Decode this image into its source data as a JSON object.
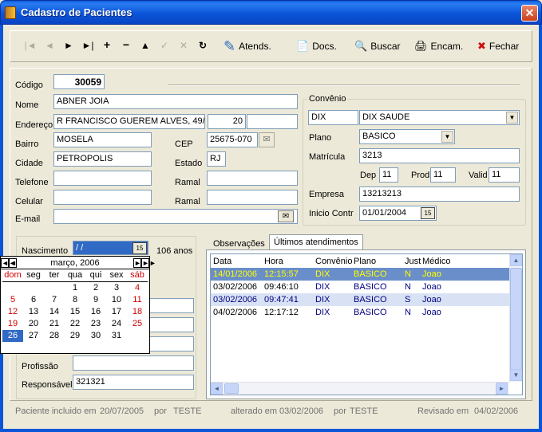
{
  "window": {
    "title": "Cadastro de Pacientes",
    "close": "✕"
  },
  "toolbar": {
    "nav": [
      "|◄",
      "◄",
      "►",
      "►|",
      "+",
      "−",
      "▲",
      "✓",
      "✕",
      "↻"
    ],
    "buttons": [
      {
        "icon": "✎",
        "label": "Atends."
      },
      {
        "icon": "📄",
        "label": "Docs."
      },
      {
        "icon": "🔍",
        "label": "Buscar"
      },
      {
        "icon": "🖨",
        "label": "Encam."
      },
      {
        "icon": "✖",
        "label": "Fechar"
      }
    ]
  },
  "form": {
    "codigo_label": "Código",
    "codigo": "30059",
    "nome_label": "Nome",
    "nome": "ABNER JOIA",
    "endereco_label": "Endereço",
    "endereco": "R FRANCISCO GUEREM ALVES, 49/",
    "numero": "20",
    "complemento": "",
    "bairro_label": "Bairro",
    "bairro": "MOSELA",
    "cep_label": "CEP",
    "cep": "25675-070",
    "cidade_label": "Cidade",
    "cidade": "PETROPOLIS",
    "estado_label": "Estado",
    "estado": "RJ",
    "telefone_label": "Telefone",
    "telefone": "",
    "ramal_label": "Ramal",
    "ramal1": "",
    "ramal2": "",
    "celular_label": "Celular",
    "celular": "",
    "email_label": "E-mail",
    "email": "",
    "nascimento_label": "Nascimento",
    "nascimento": " / /",
    "idade": "106 anos",
    "profissao_label": "Profissão",
    "profissao": "",
    "responsavel_label": "Responsável",
    "responsavel": "321321"
  },
  "convenio": {
    "title": "Convênio",
    "codigo": "DIX",
    "nome": "DIX SAUDE",
    "plano_label": "Plano",
    "plano": "BASICO",
    "matricula_label": "Matrícula",
    "matricula": "3213",
    "dep_label": "Dep",
    "dep": "11",
    "prod_label": "Prod",
    "prod": "11",
    "valid_label": "Valid",
    "valid": "11",
    "empresa_label": "Empresa",
    "empresa": "13213213",
    "inicio_label": "Inicio Contr",
    "inicio": "01/01/2004"
  },
  "tabs": [
    "Observações",
    "Últimos atendimentos"
  ],
  "table": {
    "headers": [
      "Data",
      "Hora",
      "Convênio",
      "Plano",
      "Just",
      "Médico"
    ],
    "rows": [
      [
        "14/01/2006",
        "12:15:57",
        "DIX",
        "BASICO",
        "N",
        "Joao"
      ],
      [
        "03/02/2006",
        "09:46:10",
        "DIX",
        "BASICO",
        "N",
        "Joao"
      ],
      [
        "03/02/2006",
        "09:47:41",
        "DIX",
        "BASICO",
        "S",
        "Joao"
      ],
      [
        "04/02/2006",
        "12:17:12",
        "DIX",
        "BASICO",
        "N",
        "Joao"
      ]
    ]
  },
  "calendar": {
    "month": "março, 2006",
    "weekdays": [
      "dom",
      "seg",
      "ter",
      "qua",
      "qui",
      "sex",
      "sáb"
    ],
    "days": [
      "",
      "",
      "",
      "1",
      "2",
      "3",
      "4",
      "5",
      "6",
      "7",
      "8",
      "9",
      "10",
      "11",
      "12",
      "13",
      "14",
      "15",
      "16",
      "17",
      "18",
      "19",
      "20",
      "21",
      "22",
      "23",
      "24",
      "25",
      "26",
      "27",
      "28",
      "29",
      "30",
      "31",
      ""
    ],
    "selected": "26"
  },
  "footer": {
    "incluido_label": "Paciente incluido em",
    "incluido": "20/07/2005",
    "por1": "por",
    "user1": "TESTE",
    "alterado_label": "alterado em",
    "alterado": "03/02/2006",
    "por2": "por",
    "user2": "TESTE",
    "revisado_label": "Revisado em",
    "revisado": "04/02/2006"
  },
  "colors": {
    "title_bar": "#0b55d8",
    "selected_row": "#6a8ec9",
    "weekend": "#d00000"
  }
}
